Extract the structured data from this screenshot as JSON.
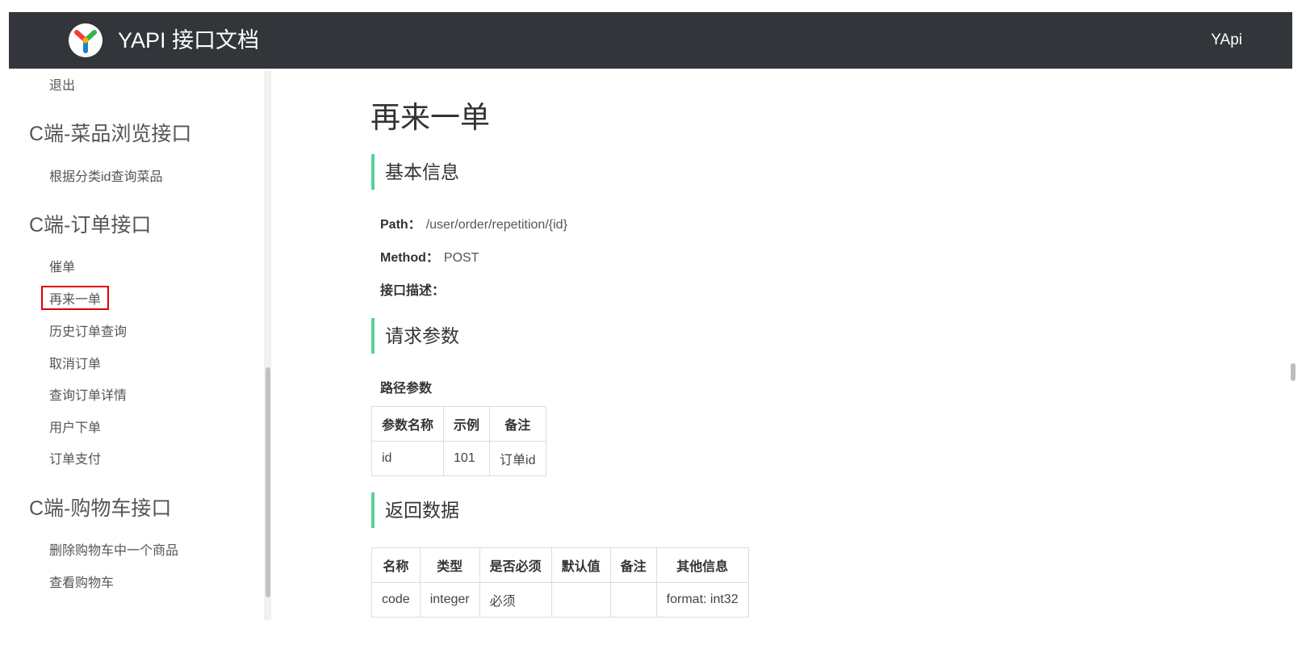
{
  "header": {
    "brand": "YAPI 接口文档",
    "nav_right": "YApi"
  },
  "sidebar": {
    "items": [
      {
        "type": "sub",
        "label": "退出"
      },
      {
        "type": "group",
        "label": "C端-菜品浏览接口"
      },
      {
        "type": "sub",
        "label": "根据分类id查询菜品"
      },
      {
        "type": "group",
        "label": "C端-订单接口"
      },
      {
        "type": "sub",
        "label": "催单"
      },
      {
        "type": "sub",
        "label": "再来一单",
        "active": true
      },
      {
        "type": "sub",
        "label": "历史订单查询"
      },
      {
        "type": "sub",
        "label": "取消订单"
      },
      {
        "type": "sub",
        "label": "查询订单详情"
      },
      {
        "type": "sub",
        "label": "用户下单"
      },
      {
        "type": "sub",
        "label": "订单支付"
      },
      {
        "type": "group",
        "label": "C端-购物车接口"
      },
      {
        "type": "sub",
        "label": "删除购物车中一个商品"
      },
      {
        "type": "sub",
        "label": "查看购物车"
      }
    ]
  },
  "main": {
    "title": "再来一单",
    "basic_info": {
      "heading": "基本信息",
      "path_label": "Path：",
      "path_value": "/user/order/repetition/{id}",
      "method_label": "Method：",
      "method_value": "POST",
      "desc_label": "接口描述："
    },
    "request": {
      "heading": "请求参数",
      "path_params_label": "路径参数",
      "path_params_headers": [
        "参数名称",
        "示例",
        "备注"
      ],
      "path_params_rows": [
        [
          "id",
          "101",
          "订单id"
        ]
      ]
    },
    "response": {
      "heading": "返回数据",
      "headers": [
        "名称",
        "类型",
        "是否必须",
        "默认值",
        "备注",
        "其他信息"
      ],
      "rows": [
        [
          "code",
          "integer",
          "必须",
          "",
          "",
          "format: int32"
        ]
      ]
    }
  },
  "colors": {
    "topbar": "#32363a",
    "section_accent": "#59d09a",
    "active_outline": "#e00000"
  }
}
